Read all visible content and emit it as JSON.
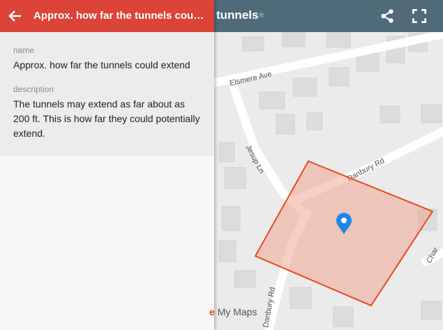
{
  "map": {
    "title": "tunnels",
    "star_icon": "star-icon",
    "share_icon": "share-icon",
    "fullscreen_icon": "fullscreen-icon",
    "streets": [
      "Elsmere Ave",
      "Jesup Ln",
      "Danbury Rd",
      "Danbury Rd",
      "Char"
    ],
    "marker_icon": "location-pin-icon",
    "colors": {
      "topbar": "#4f6b7a",
      "land": "#ebebeb",
      "road": "#ffffff",
      "building": "#dcdcdc",
      "polygon_fill": "#f0a08a",
      "polygon_stroke": "#e64a19",
      "marker": "#1e88e5"
    },
    "attribution": {
      "brand_letter": "e",
      "label": "My Maps"
    }
  },
  "panel": {
    "back_icon": "arrow-back-icon",
    "header_title": "Approx. how far the tunnels could ex...",
    "header_color": "#db4437",
    "name_label": "name",
    "name_value": "Approx. how far the tunnels could extend",
    "description_label": "description",
    "description_value": "The tunnels may extend as far about as 200 ft. This is how far they could potentially extend."
  }
}
